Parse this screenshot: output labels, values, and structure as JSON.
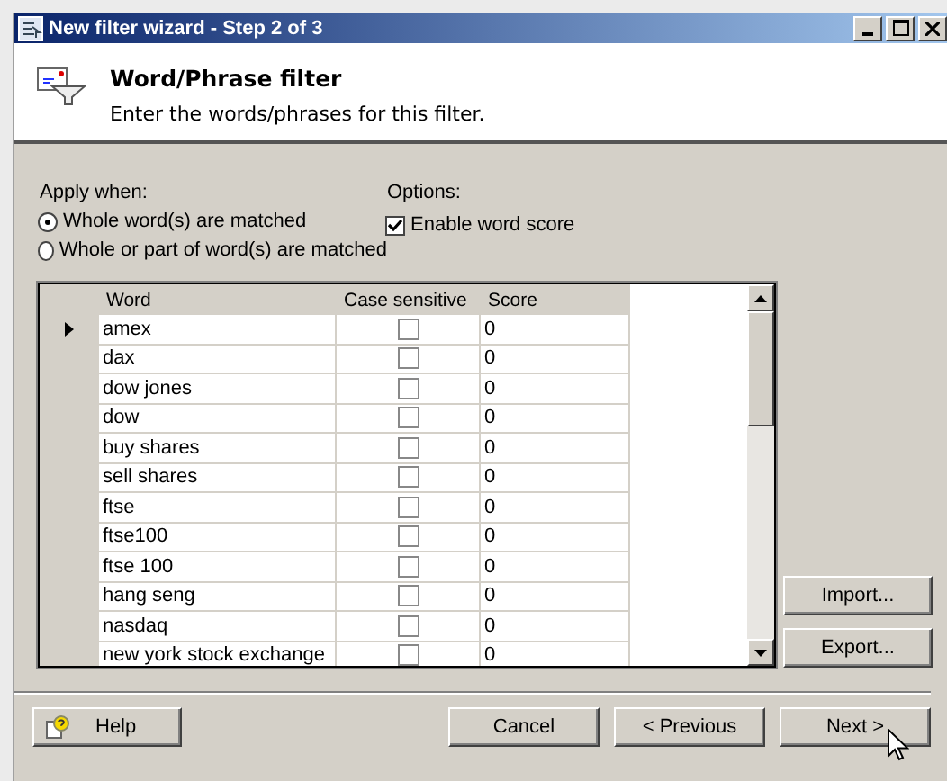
{
  "window": {
    "title": "New filter wizard - Step 2 of 3"
  },
  "header": {
    "title": "Word/Phrase filter",
    "subtitle": "Enter the words/phrases for this filter."
  },
  "apply_when": {
    "label": "Apply when:",
    "options": [
      {
        "label": "Whole word(s) are matched",
        "selected": true
      },
      {
        "label": "Whole or part of word(s) are matched",
        "selected": false
      }
    ]
  },
  "options": {
    "label": "Options:",
    "items": [
      {
        "label": "Enable word score",
        "checked": true
      }
    ]
  },
  "table": {
    "columns": [
      "Word",
      "Case sensitive",
      "Score"
    ],
    "rows": [
      {
        "word": "amex",
        "case_sensitive": false,
        "score": "0",
        "current": true
      },
      {
        "word": "dax",
        "case_sensitive": false,
        "score": "0",
        "current": false
      },
      {
        "word": "dow jones",
        "case_sensitive": false,
        "score": "0",
        "current": false
      },
      {
        "word": "dow",
        "case_sensitive": false,
        "score": "0",
        "current": false
      },
      {
        "word": "buy shares",
        "case_sensitive": false,
        "score": "0",
        "current": false
      },
      {
        "word": "sell shares",
        "case_sensitive": false,
        "score": "0",
        "current": false
      },
      {
        "word": "ftse",
        "case_sensitive": false,
        "score": "0",
        "current": false
      },
      {
        "word": "ftse100",
        "case_sensitive": false,
        "score": "0",
        "current": false
      },
      {
        "word": "ftse 100",
        "case_sensitive": false,
        "score": "0",
        "current": false
      },
      {
        "word": "hang seng",
        "case_sensitive": false,
        "score": "0",
        "current": false
      },
      {
        "word": "nasdaq",
        "case_sensitive": false,
        "score": "0",
        "current": false
      },
      {
        "word": "new york stock exchange",
        "case_sensitive": false,
        "score": "0",
        "current": false
      }
    ]
  },
  "side_buttons": [
    "Import...",
    "Export..."
  ],
  "footer": {
    "help": "Help",
    "buttons": [
      "Cancel",
      "< Previous",
      "Next >"
    ]
  }
}
